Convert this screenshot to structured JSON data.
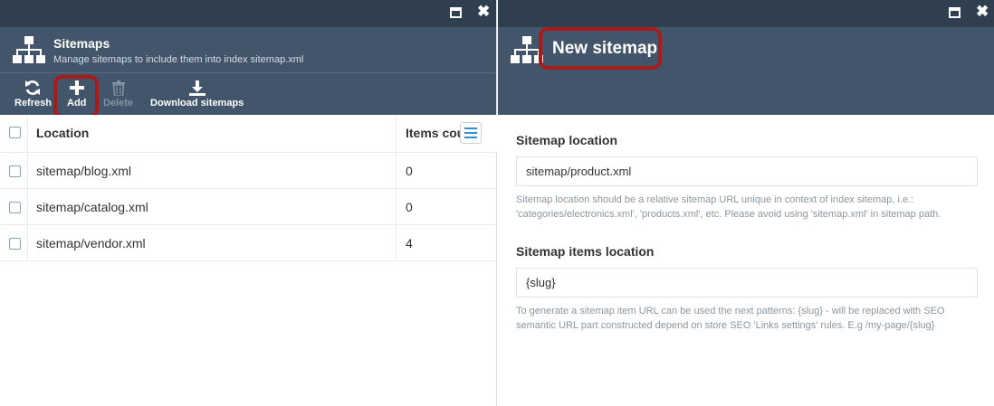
{
  "left_blade": {
    "title": "Sitemaps",
    "subtitle": "Manage sitemaps to include them into index sitemap.xml",
    "toolbar": {
      "refresh_label": "Refresh",
      "add_label": "Add",
      "delete_label": "Delete",
      "download_label": "Download sitemaps"
    },
    "grid": {
      "columns": {
        "location": "Location",
        "items_count": "Items cou…"
      },
      "rows": [
        {
          "location": "sitemap/blog.xml",
          "items_count": "0"
        },
        {
          "location": "sitemap/catalog.xml",
          "items_count": "0"
        },
        {
          "location": "sitemap/vendor.xml",
          "items_count": "4"
        }
      ]
    }
  },
  "right_blade": {
    "title": "New sitemap",
    "form": {
      "location_label": "Sitemap location",
      "location_value": "sitemap/product.xml",
      "location_help": "Sitemap location should be a relative sitemap URL unique in context of index sitemap, i.e.: 'categories/electronics.xml', 'products.xml', etc. Please avoid using 'sitemap.xml' in sitemap path.",
      "items_location_label": "Sitemap items location",
      "items_location_value": "{slug}",
      "items_location_help": "To generate a sitemap item URL can be used the next patterns: {slug} - will be replaced with SEO semantic URL part constructed depend on store SEO 'Links settings' rules. E.g /my-page/{slug}"
    }
  },
  "colors": {
    "titlebar": "#2f3f4f",
    "header": "#43556a",
    "highlight": "#a71b1b",
    "accent": "#2f8fd8"
  },
  "icons": [
    "maximize-icon",
    "close-icon",
    "sitemap-icon",
    "refresh-icon",
    "plus-icon",
    "trash-icon",
    "download-icon",
    "column-menu-icon"
  ]
}
